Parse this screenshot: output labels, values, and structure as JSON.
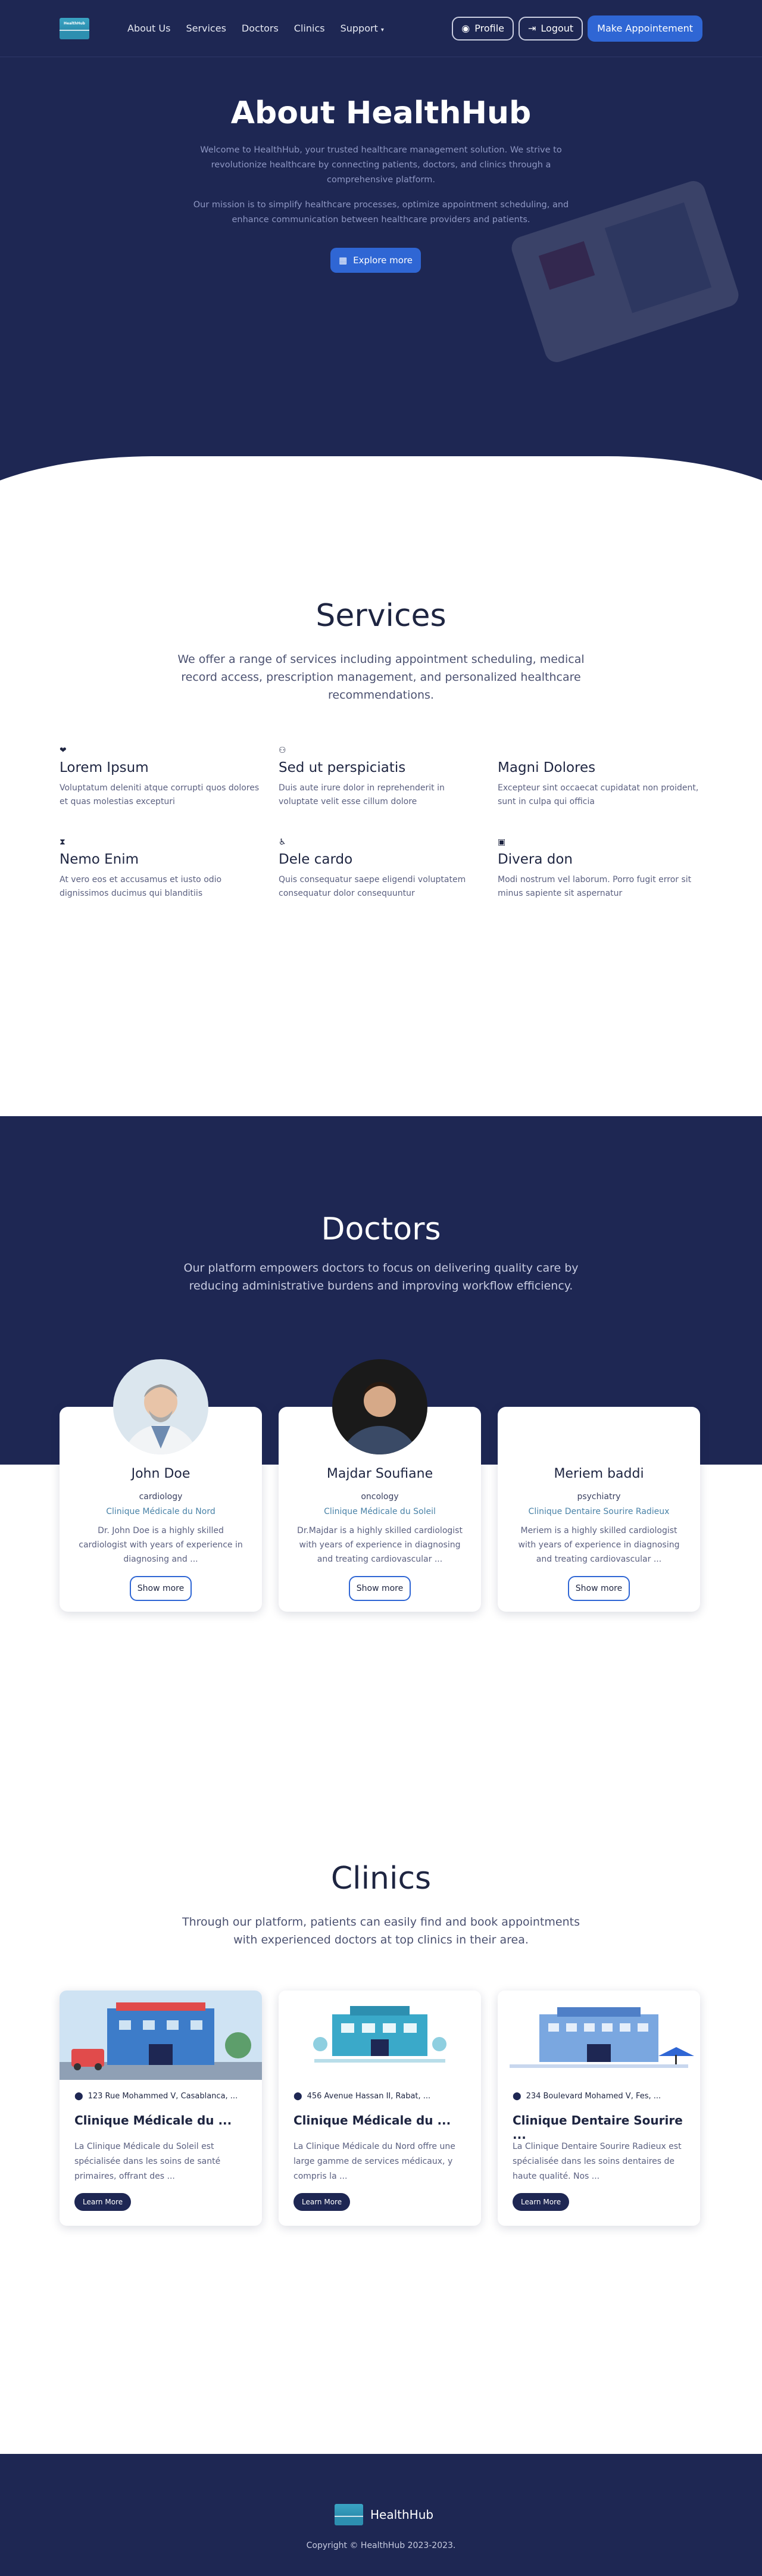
{
  "nav": {
    "logo_text": "HealthHub",
    "links": [
      "About Us",
      "Services",
      "Doctors",
      "Clinics",
      "Support"
    ],
    "profile": "Profile",
    "logout": "Logout",
    "cta": "Make Appointement"
  },
  "hero": {
    "title": "About HealthHub",
    "p1": "Welcome to HealthHub, your trusted healthcare management solution. We strive to revolutionize healthcare by connecting patients, doctors, and clinics through a comprehensive platform.",
    "p2": "Our mission is to simplify healthcare processes, optimize appointment scheduling, and enhance communication between healthcare providers and patients.",
    "button": "Explore more"
  },
  "services": {
    "title": "Services",
    "subtitle": "We offer a range of services including appointment scheduling, medical record access, prescription management, and personalized healthcare recommendations.",
    "items": [
      {
        "icon": "heart-pulse-icon",
        "glyph": "❤",
        "title": "Lorem Ipsum",
        "desc": "Voluptatum deleniti atque corrupti quos dolores et quas molestias excepturi"
      },
      {
        "icon": "binoculars-icon",
        "glyph": "⚇",
        "title": "Sed ut perspiciatis",
        "desc": "Duis aute irure dolor in reprehenderit in voluptate velit esse cillum dolore"
      },
      {
        "icon": "",
        "glyph": "",
        "title": "Magni Dolores",
        "desc": "Excepteur sint occaecat cupidatat non proident, sunt in culpa qui officia"
      },
      {
        "icon": "hourglass-icon",
        "glyph": "⧗",
        "title": "Nemo Enim",
        "desc": "At vero eos et accusamus et iusto odio dignissimos ducimus qui blanditiis"
      },
      {
        "icon": "wheelchair-icon",
        "glyph": "♿",
        "title": "Dele cardo",
        "desc": "Quis consequatur saepe eligendi voluptatem consequatur dolor consequuntur"
      },
      {
        "icon": "clipboard-icon",
        "glyph": "▣",
        "title": "Divera don",
        "desc": "Modi nostrum vel laborum. Porro fugit error sit minus sapiente sit aspernatur"
      }
    ]
  },
  "doctors": {
    "title": "Doctors",
    "subtitle": "Our platform empowers doctors to focus on delivering quality care by reducing administrative burdens and improving workflow efficiency.",
    "button": "Show more",
    "items": [
      {
        "name": "John Doe",
        "specialty": "cardiology",
        "clinic": "Clinique Médicale du Nord",
        "desc": "Dr. John Doe is a highly skilled cardiologist with years of experience in diagnosing and ..."
      },
      {
        "name": "Majdar Soufiane",
        "specialty": "oncology",
        "clinic": "Clinique Médicale du Soleil",
        "desc": "Dr.Majdar is a highly skilled cardiologist with years of experience in diagnosing and treating cardiovascular ..."
      },
      {
        "name": "Meriem baddi",
        "specialty": "psychiatry",
        "clinic": "Clinique Dentaire Sourire Radieux",
        "desc": "Meriem is a highly skilled cardiologist with years of experience in diagnosing and treating cardiovascular ..."
      }
    ]
  },
  "clinics": {
    "title": "Clinics",
    "subtitle": "Through our platform, patients can easily find and book appointments with experienced doctors at top clinics in their area.",
    "button": "Learn More",
    "items": [
      {
        "address": "123 Rue Mohammed V, Casablanca, ...",
        "name": "Clinique Médicale du ...",
        "desc": "La Clinique Médicale du Soleil est spécialisée dans les soins de santé primaires, offrant des ..."
      },
      {
        "address": "456 Avenue Hassan II, Rabat, ...",
        "name": "Clinique Médicale du ...",
        "desc": "La Clinique Médicale du Nord offre une large gamme de services médicaux, y compris la ..."
      },
      {
        "address": "234 Boulevard Mohamed V, Fes, ...",
        "name": "Clinique Dentaire Sourire ...",
        "desc": "La Clinique Dentaire Sourire Radieux est spécialisée dans les soins dentaires de haute qualité. Nos ..."
      }
    ]
  },
  "footer": {
    "brand": "HealthHub",
    "copyright": "Copyright © HealthHub 2023-2023."
  }
}
